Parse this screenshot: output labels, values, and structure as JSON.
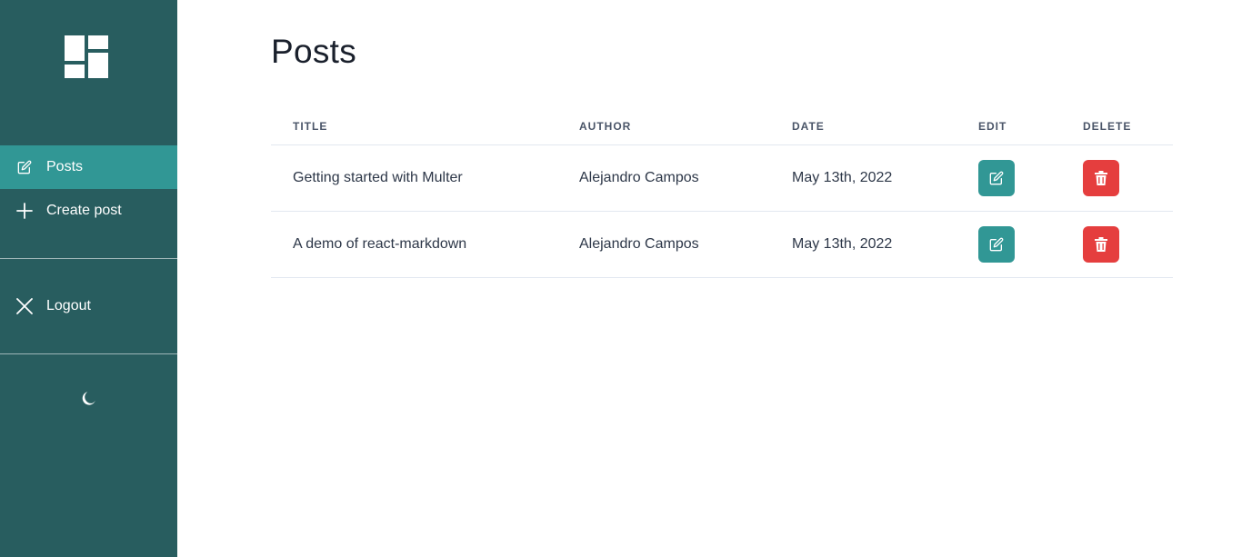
{
  "sidebar": {
    "logo_icon": "dashboard-icon",
    "nav": [
      {
        "label": "Posts",
        "icon": "edit-icon",
        "active": true
      },
      {
        "label": "Create post",
        "icon": "plus-icon",
        "active": false
      }
    ],
    "logout": {
      "label": "Logout",
      "icon": "close-icon"
    },
    "theme_toggle_icon": "moon-icon",
    "colors": {
      "background": "#285d5f",
      "active": "#319795"
    }
  },
  "main": {
    "title": "Posts",
    "table": {
      "headers": {
        "title": "TITLE",
        "author": "AUTHOR",
        "date": "DATE",
        "edit": "EDIT",
        "delete": "DELETE"
      },
      "rows": [
        {
          "title": "Getting started with Multer",
          "author": "Alejandro Campos",
          "date": "May 13th, 2022"
        },
        {
          "title": "A demo of react-markdown",
          "author": "Alejandro Campos",
          "date": "May 13th, 2022"
        }
      ]
    },
    "colors": {
      "edit_button": "#319795",
      "delete_button": "#e53e3e"
    }
  }
}
